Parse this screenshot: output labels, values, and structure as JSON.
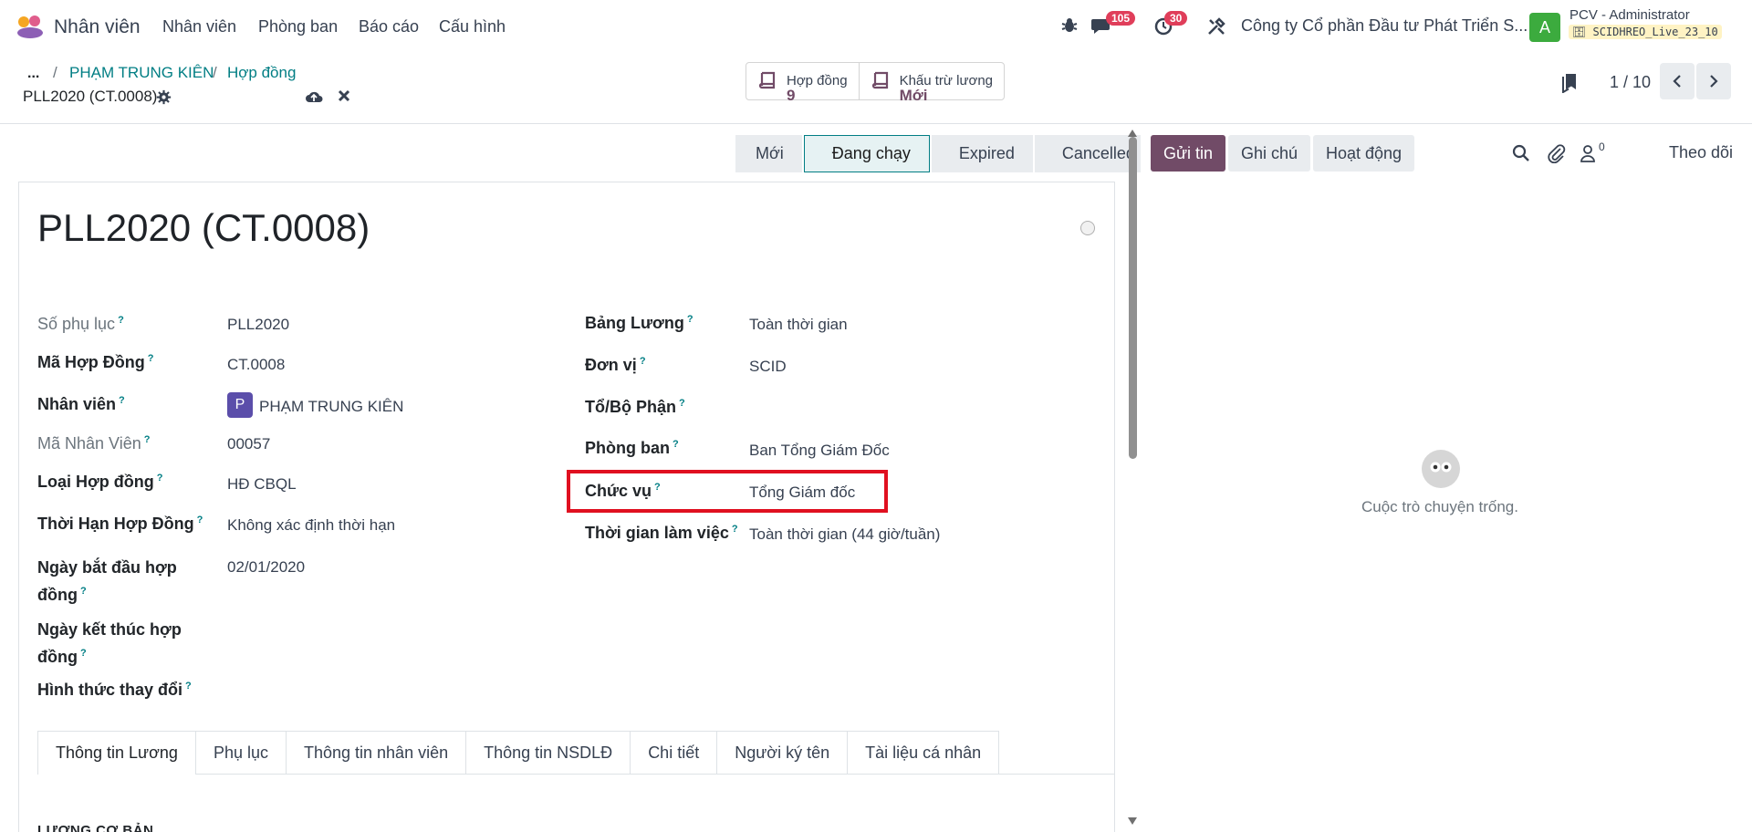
{
  "navbar": {
    "app_name": "Nhân viên",
    "menu": [
      "Nhân viên",
      "Phòng ban",
      "Báo cáo",
      "Cấu hình"
    ],
    "messages_badge": "105",
    "activities_badge": "30",
    "company": "Công ty Cổ phần Đầu tư Phát Triển S...",
    "avatar_letter": "A",
    "user_name": "PCV - Administrator",
    "database": "SCIDHREO_Live_23_10"
  },
  "breadcrumb": {
    "dots": "...",
    "items": [
      "PHẠM TRUNG KIÊN",
      "Hợp đồng"
    ],
    "current": "PLL2020 (CT.0008)"
  },
  "smart_buttons": [
    {
      "label": "Hợp đồng",
      "value": "9"
    },
    {
      "label": "Khấu trừ lương",
      "value": "Mới"
    }
  ],
  "pager": {
    "value": "1 / 10"
  },
  "statusbar": {
    "stages": [
      "Mới",
      "Đang chạy",
      "Expired",
      "Cancelled"
    ],
    "active": "Đang chạy"
  },
  "form": {
    "title": "PLL2020 (CT.0008)",
    "left_fields": [
      {
        "label": "Số phụ lục",
        "value": "PLL2020"
      },
      {
        "label": "Mã Hợp Đồng",
        "value": "CT.0008"
      },
      {
        "label": "Nhân viên",
        "value": "PHẠM TRUNG KIÊN",
        "avatar": "P"
      },
      {
        "label": "Mã Nhân Viên",
        "value": "00057"
      },
      {
        "label": "Loại Hợp đồng",
        "value": "HĐ CBQL"
      },
      {
        "label": "Thời Hạn Hợp Đồng",
        "value": "Không xác định thời hạn"
      },
      {
        "label": "Ngày bắt đầu hợp đồng",
        "value": "02/01/2020"
      },
      {
        "label": "Ngày kết thúc hợp đồng",
        "value": ""
      },
      {
        "label": "Hình thức thay đổi",
        "value": ""
      }
    ],
    "right_fields": [
      {
        "label": "Bảng Lương",
        "value": "Toàn thời gian"
      },
      {
        "label": "Đơn vị",
        "value": "SCID"
      },
      {
        "label": "Tổ/Bộ Phận",
        "value": ""
      },
      {
        "label": "Phòng ban",
        "value": "Ban Tổng Giám Đốc"
      },
      {
        "label": "Chức vụ",
        "value": "Tổng Giám đốc"
      },
      {
        "label": "Thời gian làm việc",
        "value": "Toàn thời gian (44 giờ/tuần)"
      }
    ],
    "help_mark": "?"
  },
  "tabs": [
    "Thông tin Lương",
    "Phụ lục",
    "Thông tin nhân viên",
    "Thông tin NSDLĐ",
    "Chi tiết",
    "Người ký tên",
    "Tài liệu cá nhân"
  ],
  "section_heading": "LƯƠNG CƠ BẢN",
  "chatter": {
    "send_message": "Gửi tin",
    "log_note": "Ghi chú",
    "activities": "Hoạt động",
    "followers_count": "0",
    "follow": "Theo dõi",
    "empty_text": "Cuộc trò chuyện trống."
  },
  "colors": {
    "brand": "#714b67",
    "link": "#017e84",
    "highlight": "#e01020"
  }
}
